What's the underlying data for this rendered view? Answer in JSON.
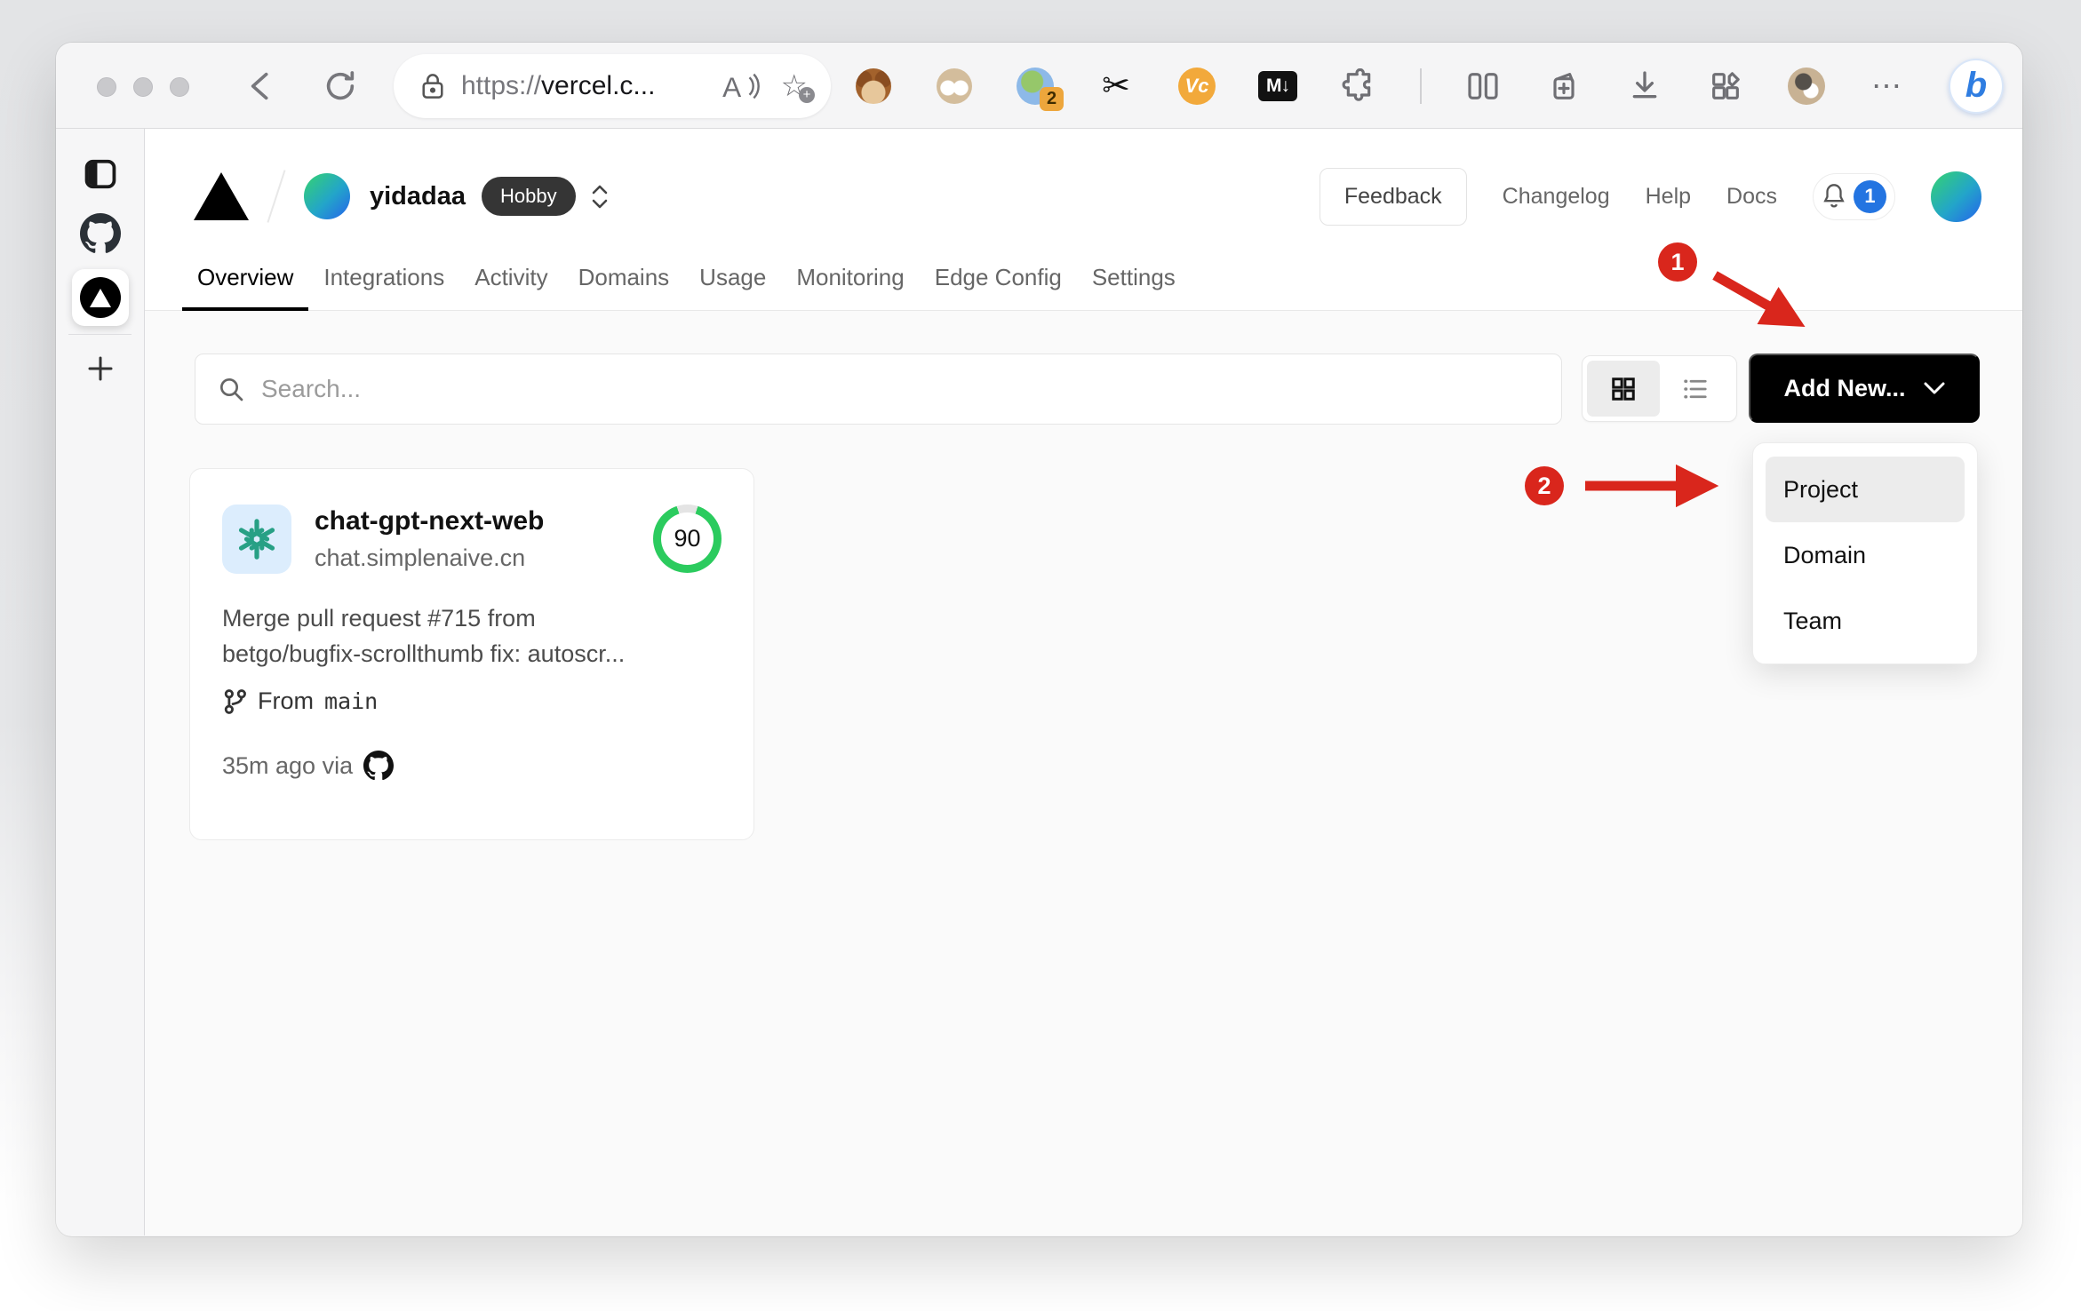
{
  "browser": {
    "url": {
      "protocol": "https://",
      "host": "vercel.c..."
    },
    "extensions": {
      "badge_count": "2",
      "vc_label": "Vc",
      "md_label": "M↓",
      "bing_label": "b"
    }
  },
  "vercel": {
    "team": {
      "name": "yidadaa",
      "plan": "Hobby"
    },
    "header_actions": [
      {
        "label": "Feedback"
      },
      {
        "label": "Changelog"
      },
      {
        "label": "Help"
      },
      {
        "label": "Docs"
      }
    ],
    "notification_count": "1",
    "tabs": [
      {
        "label": "Overview",
        "active": true
      },
      {
        "label": "Integrations"
      },
      {
        "label": "Activity"
      },
      {
        "label": "Domains"
      },
      {
        "label": "Usage"
      },
      {
        "label": "Monitoring"
      },
      {
        "label": "Edge Config"
      },
      {
        "label": "Settings"
      }
    ],
    "search": {
      "placeholder": "Search..."
    },
    "add_new_label": "Add New...",
    "project_card": {
      "name": "chat-gpt-next-web",
      "domain": "chat.simplenaive.cn",
      "score": "90",
      "commit_line1": "Merge pull request #715 from",
      "commit_line2": "betgo/bugfix-scrollthumb fix: autoscr...",
      "branch_prefix": "From",
      "branch_name": "main",
      "deploy_meta": "35m ago via"
    },
    "dropdown": {
      "items": [
        {
          "label": "Project",
          "active": true
        },
        {
          "label": "Domain"
        },
        {
          "label": "Team"
        }
      ]
    }
  },
  "annotations": {
    "step1": "1",
    "step2": "2"
  },
  "colors": {
    "annotation_red": "#d9261c",
    "score_green": "#2bcb5e",
    "notification_blue": "#2374e1",
    "button_black": "#000000",
    "openai_teal": "#27a085"
  }
}
